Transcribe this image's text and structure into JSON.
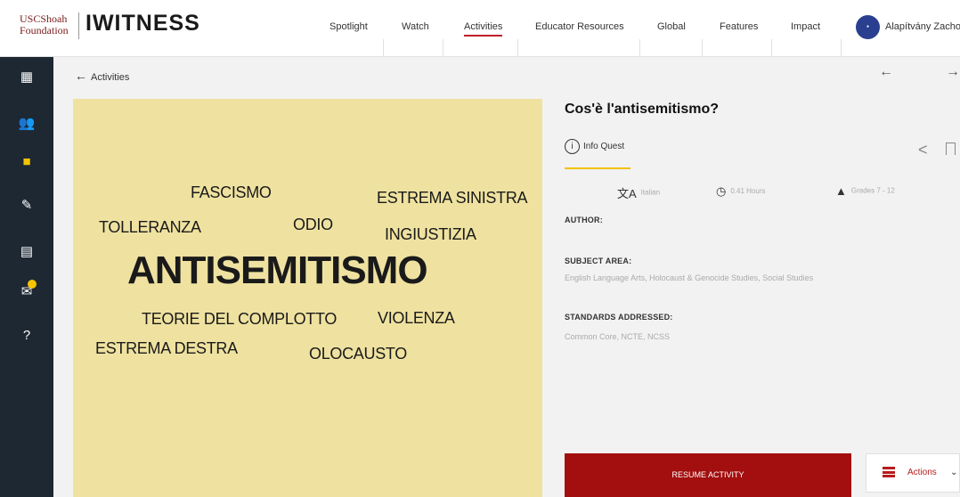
{
  "header": {
    "logo_usc": "USCShoah Foundation",
    "logo_line1": "USCShoah",
    "logo_line2": "Foundation",
    "logo_brand": "IWITNESS",
    "nav": [
      "Spotlight",
      "Watch",
      "Activities",
      "Educator Resources",
      "Global",
      "Features",
      "Impact"
    ],
    "active_nav": "Activities",
    "user_name": "Alapítvány Zacho"
  },
  "sidebar": {
    "icons": [
      "dashboard-icon",
      "users-icon",
      "briefcase-icon",
      "pen-icon",
      "archive-icon",
      "inbox-icon",
      "help-icon"
    ],
    "active_icon": "briefcase-icon"
  },
  "breadcrumb": {
    "back_label": "Activities"
  },
  "word_cloud": {
    "words": [
      "FASCISMO",
      "ESTREMA SINISTRA",
      "TOLLERANZA",
      "ODIO",
      "INGIUSTIZIA",
      "ANTISEMITISMO",
      "TEORIE DEL COMPLOTTO",
      "VIOLENZA",
      "ESTREMA DESTRA",
      "OLOCAUSTO"
    ]
  },
  "activity": {
    "title": "Cos'è l'antisemitismo?",
    "type": "Info Quest",
    "language": "Italian",
    "duration": "0.41 Hours",
    "grades": "Grades 7 - 12",
    "author_label": "AUTHOR:",
    "subject_label": "SUBJECT AREA:",
    "subject_value": "English Language Arts, Holocaust & Genocide Studies, Social Studies",
    "standards_label": "STANDARDS ADDRESSED:",
    "standards_value": "Common Core, NCTE, NCSS",
    "resume_label": "RESUME ACTIVITY",
    "actions_label": "Actions"
  },
  "colors": {
    "sidebar_bg": "#1d2833",
    "accent_yellow": "#f5c400",
    "cloud_bg": "#efe2a0",
    "resume_bg": "#a30e0e",
    "nav_underline": "#c0202a"
  }
}
